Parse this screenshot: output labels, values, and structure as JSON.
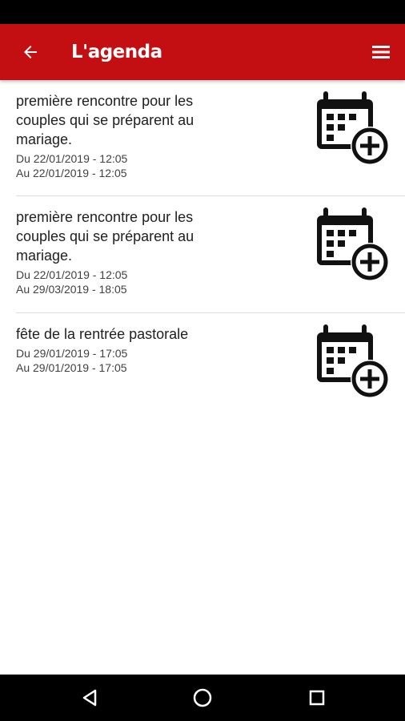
{
  "app_bar": {
    "title": "L'agenda",
    "back_icon": "arrow-left-icon",
    "menu_icon": "hamburger-menu-icon",
    "background": "#c30f12"
  },
  "events": [
    {
      "title": "première rencontre pour les couples qui se préparent au mariage.",
      "start": "Du 22/01/2019 - 12:05",
      "end": "Au 22/01/2019 - 12:05",
      "icon": "calendar-add-icon"
    },
    {
      "title": "première rencontre pour les couples qui se préparent au mariage.",
      "start": "Du 22/01/2019 - 12:05",
      "end": "Au 29/03/2019 - 18:05",
      "icon": "calendar-add-icon"
    },
    {
      "title": "fête de la rentrée pastorale",
      "start": "Du 29/01/2019 - 17:05",
      "end": "Au 29/01/2019 - 17:05",
      "icon": "calendar-add-icon"
    }
  ],
  "nav_bar": {
    "back_icon": "triangle-back-icon",
    "home_icon": "circle-home-icon",
    "recents_icon": "square-recents-icon"
  }
}
